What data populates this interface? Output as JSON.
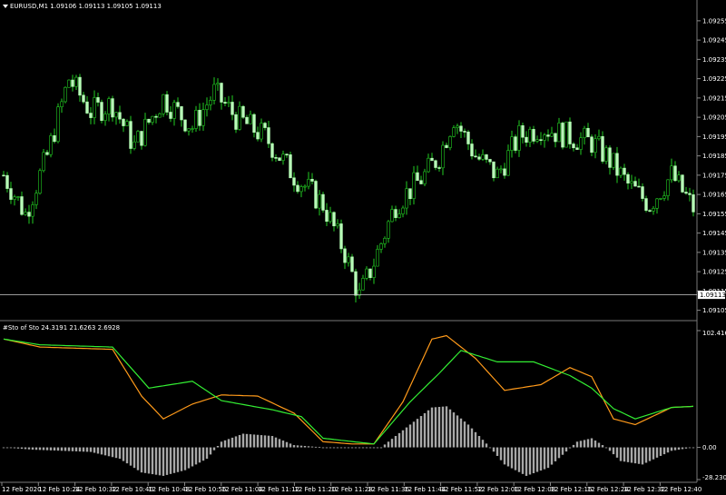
{
  "colors": {
    "background": "#000000",
    "bull_candle": "#b8ffb8",
    "bear_candle": "#b8ffb8",
    "wick": "#22cc22",
    "k_line": "#ff9a1a",
    "d_line": "#33ee33",
    "histogram": "#a8a8a8",
    "axis_text": "#ffffff",
    "price_line": "#ffffff"
  },
  "main_chart": {
    "header": "EURUSD,M1  1.09106 1.09113 1.09105 1.09113",
    "current_price_label": "1.09113",
    "price_axis": [
      "1.09255",
      "1.09245",
      "1.09235",
      "1.09225",
      "1.09215",
      "1.09205",
      "1.09195",
      "1.09185",
      "1.09175",
      "1.09165",
      "1.09155",
      "1.09145",
      "1.09135",
      "1.09125",
      "1.09115",
      "1.09105"
    ]
  },
  "sub_chart": {
    "header": "#Sto of Sto 24.3191 21.6263 2.6928",
    "axis_labels": [
      "102.4165",
      "0.00",
      "-28.2305"
    ]
  },
  "time_axis": [
    "12 Feb 2020",
    "12 Feb 10:24",
    "12 Feb 10:32",
    "12 Feb 10:40",
    "12 Feb 10:48",
    "12 Feb 10:56",
    "12 Feb 11:04",
    "12 Feb 11:12",
    "12 Feb 11:20",
    "12 Feb 11:28",
    "12 Feb 11:36",
    "12 Feb 11:44",
    "12 Feb 11:52",
    "12 Feb 12:00",
    "12 Feb 12:08",
    "12 Feb 12:16",
    "12 Feb 12:24",
    "12 Feb 12:32",
    "12 Feb 12:40"
  ],
  "chart_data": [
    {
      "type": "candlestick",
      "title": "EURUSD,M1",
      "ylim": [
        1.09102,
        1.09262
      ],
      "current_price": 1.09113,
      "close_path": [
        [
          0,
          1.09175
        ],
        [
          6,
          1.09155
        ],
        [
          12,
          1.09185
        ],
        [
          18,
          1.09225
        ],
        [
          24,
          1.09208
        ],
        [
          30,
          1.09212
        ],
        [
          36,
          1.0919
        ],
        [
          44,
          1.09215
        ],
        [
          52,
          1.092
        ],
        [
          58,
          1.09218
        ],
        [
          64,
          1.09205
        ],
        [
          72,
          1.09195
        ],
        [
          80,
          1.09175
        ],
        [
          88,
          1.0916
        ],
        [
          94,
          1.09135
        ],
        [
          98,
          1.09112
        ],
        [
          102,
          1.0913
        ],
        [
          108,
          1.0916
        ],
        [
          116,
          1.09175
        ],
        [
          120,
          1.09185
        ],
        [
          124,
          1.09205
        ],
        [
          130,
          1.09185
        ],
        [
          136,
          1.09175
        ],
        [
          142,
          1.09195
        ],
        [
          148,
          1.092
        ],
        [
          156,
          1.09195
        ],
        [
          162,
          1.09192
        ],
        [
          166,
          1.09185
        ],
        [
          172,
          1.0917
        ],
        [
          178,
          1.0916
        ],
        [
          184,
          1.09175
        ],
        [
          190,
          1.09158
        ]
      ]
    },
    {
      "type": "line",
      "title": "#Sto of Sto",
      "values_printed": [
        24.3191,
        21.6263,
        2.6928
      ],
      "ylim": [
        -28.2305,
        102.4165
      ],
      "series": [
        {
          "key": "k",
          "points": [
            [
              0,
              95
            ],
            [
              10,
              88
            ],
            [
              20,
              87
            ],
            [
              30,
              86
            ],
            [
              38,
              45
            ],
            [
              44,
              25
            ],
            [
              52,
              38
            ],
            [
              60,
              46
            ],
            [
              70,
              45
            ],
            [
              80,
              30
            ],
            [
              88,
              5
            ],
            [
              96,
              3
            ],
            [
              102,
              3
            ],
            [
              110,
              40
            ],
            [
              118,
              95
            ],
            [
              122,
              98
            ],
            [
              130,
              78
            ],
            [
              138,
              50
            ],
            [
              148,
              55
            ],
            [
              156,
              70
            ],
            [
              162,
              62
            ],
            [
              168,
              25
            ],
            [
              174,
              20
            ],
            [
              184,
              35
            ],
            [
              190,
              36
            ]
          ]
        },
        {
          "key": "d",
          "points": [
            [
              0,
              95
            ],
            [
              10,
              90
            ],
            [
              20,
              89
            ],
            [
              30,
              88
            ],
            [
              40,
              52
            ],
            [
              52,
              58
            ],
            [
              60,
              41
            ],
            [
              74,
              33
            ],
            [
              82,
              27
            ],
            [
              88,
              8
            ],
            [
              102,
              3
            ],
            [
              112,
              40
            ],
            [
              120,
              65
            ],
            [
              126,
              85
            ],
            [
              136,
              75
            ],
            [
              146,
              75
            ],
            [
              156,
              63
            ],
            [
              162,
              52
            ],
            [
              168,
              34
            ],
            [
              174,
              25
            ],
            [
              184,
              35
            ],
            [
              190,
              36
            ]
          ]
        }
      ],
      "histogram": [
        [
          0,
          0
        ],
        [
          8,
          -2
        ],
        [
          16,
          -3
        ],
        [
          24,
          -4
        ],
        [
          32,
          -10
        ],
        [
          38,
          -22
        ],
        [
          44,
          -25
        ],
        [
          50,
          -20
        ],
        [
          56,
          -10
        ],
        [
          60,
          5
        ],
        [
          66,
          12
        ],
        [
          74,
          10
        ],
        [
          80,
          2
        ],
        [
          88,
          0
        ],
        [
          104,
          0
        ],
        [
          110,
          15
        ],
        [
          118,
          35
        ],
        [
          122,
          36
        ],
        [
          128,
          20
        ],
        [
          134,
          0
        ],
        [
          138,
          -15
        ],
        [
          144,
          -25
        ],
        [
          150,
          -18
        ],
        [
          158,
          5
        ],
        [
          162,
          8
        ],
        [
          166,
          0
        ],
        [
          170,
          -12
        ],
        [
          176,
          -15
        ],
        [
          184,
          -3
        ],
        [
          190,
          0
        ]
      ]
    }
  ]
}
